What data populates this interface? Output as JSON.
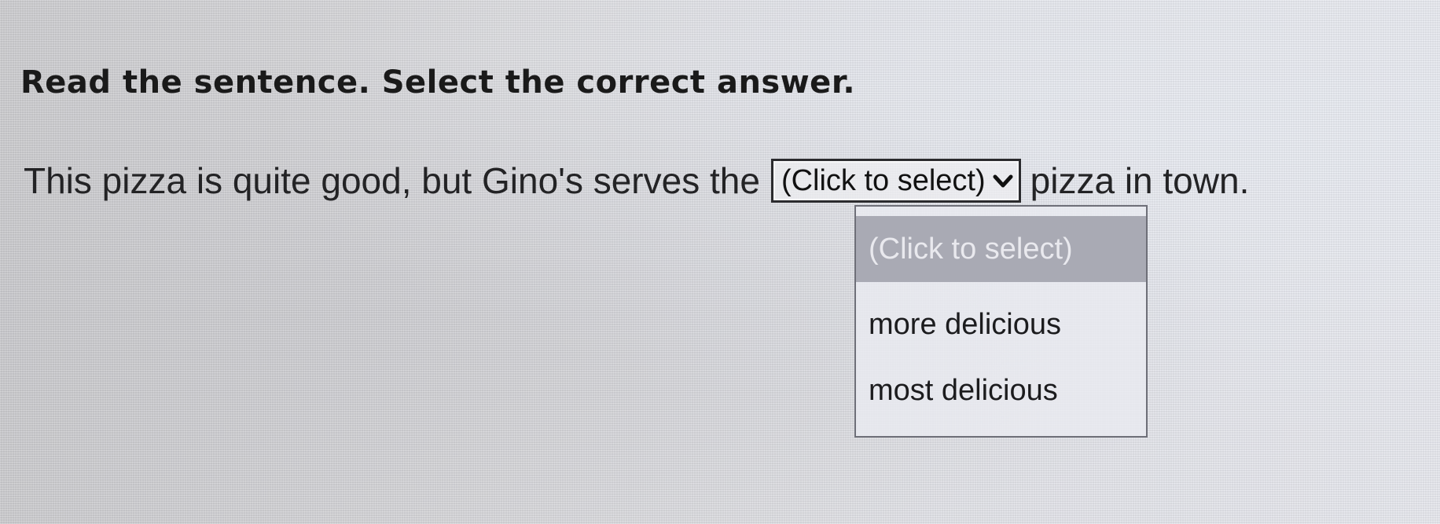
{
  "instruction": "Read the sentence. Select the correct answer.",
  "sentence": {
    "before": "This pizza is quite good, but Gino's serves the",
    "after": "pizza in town."
  },
  "select": {
    "value": "(Click to select)",
    "options": [
      "(Click to select)",
      "more delicious",
      "most delicious"
    ],
    "highlighted_option": "(Click to select)"
  }
}
